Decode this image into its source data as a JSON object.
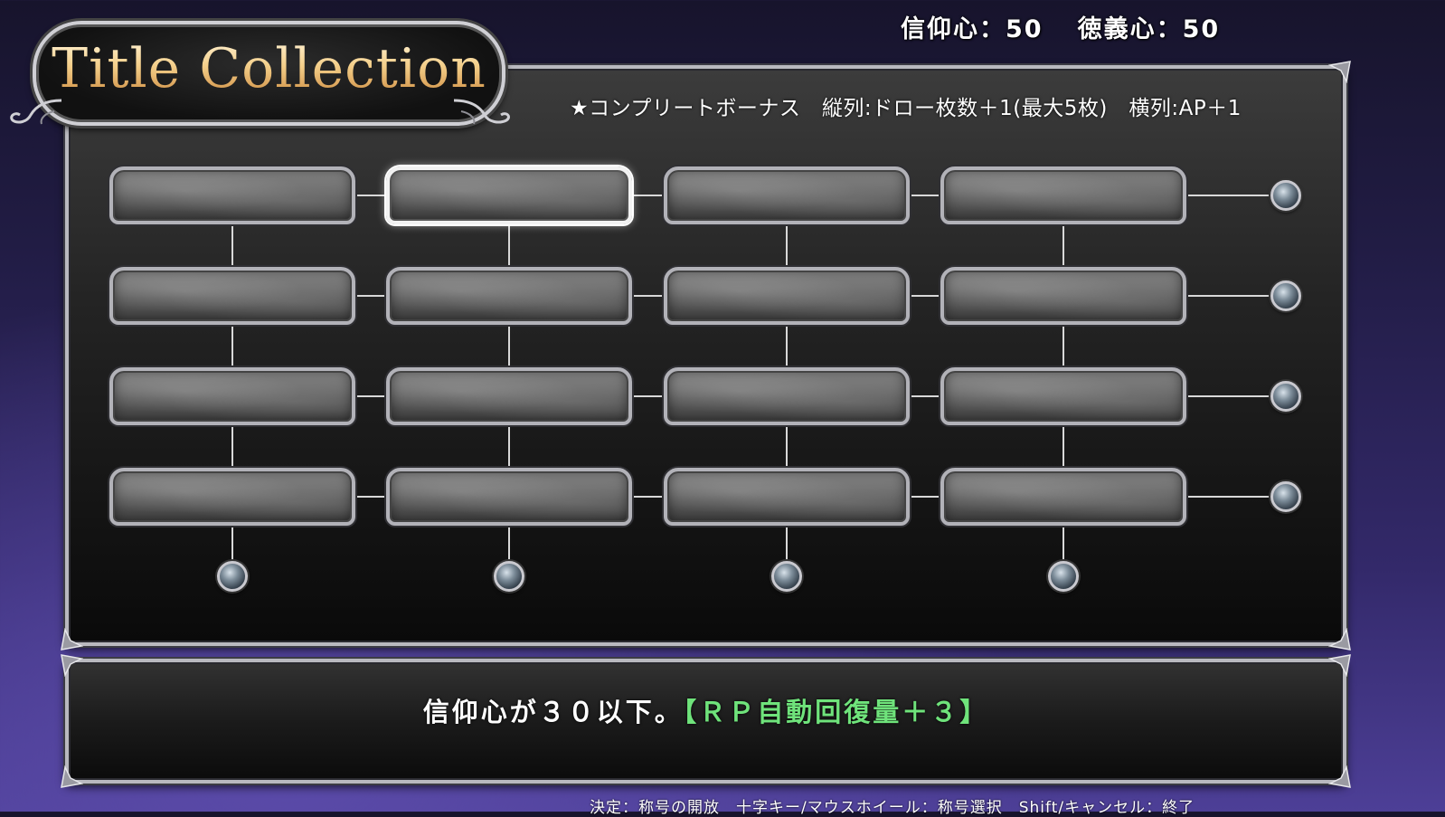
{
  "stats": {
    "faith_label": "信仰心：",
    "faith_value": "50",
    "ethics_label": "徳義心：",
    "ethics_value": "50"
  },
  "title": "Title Collection",
  "complete_bonus": "★コンプリートボーナス　縦列:ドロー枚数＋1(最大5枚)　横列:AP＋1",
  "grid": {
    "rows": 4,
    "cols": 4,
    "selected": {
      "row": 0,
      "col": 1
    },
    "slot_labels": [
      "",
      "",
      "",
      "",
      "",
      "",
      "",
      "",
      "",
      "",
      "",
      "",
      "",
      "",
      "",
      ""
    ]
  },
  "description": {
    "text": "信仰心が３０以下。",
    "bonus": "【ＲＰ自動回復量＋３】"
  },
  "footer": "決定：称号の開放　十字キー/マウスホイール：称号選択　Shift/キャンセル：終了",
  "colors": {
    "title_gold": "#f3cf88",
    "bonus_green": "#6fe37b",
    "background_purple": "#4d3f97"
  },
  "icons": {
    "row_end_marker": "orb-icon",
    "col_end_marker": "orb-icon",
    "panel_corner": "ornate-corner-icon"
  }
}
